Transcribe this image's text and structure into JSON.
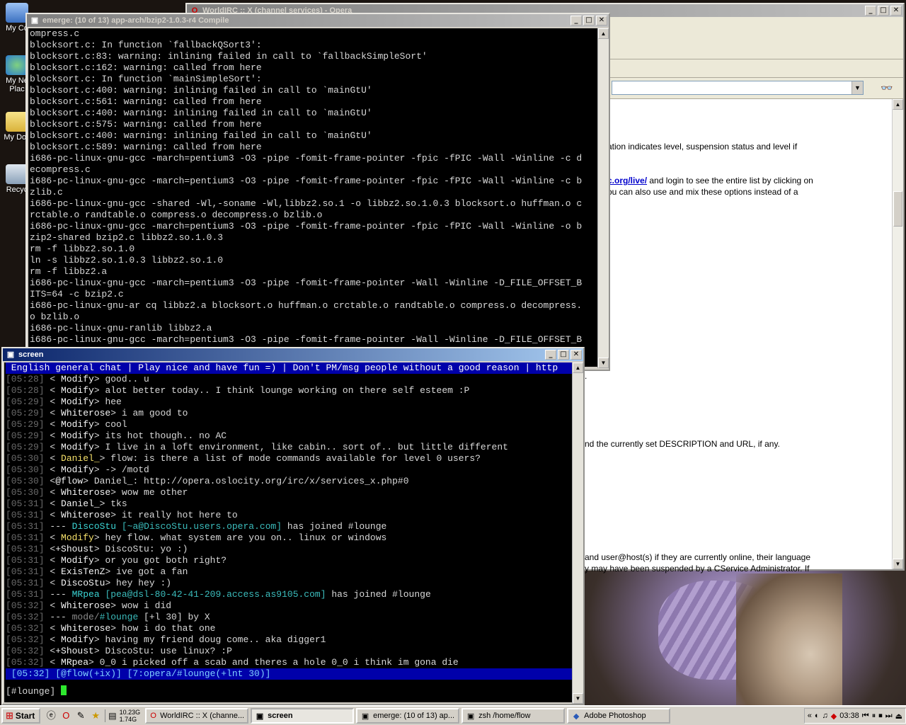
{
  "desktop": {
    "icons": [
      {
        "label": "My Co",
        "name": "my-computer"
      },
      {
        "label": "My Ne Plac",
        "name": "my-network-places"
      },
      {
        "label": "My Doc",
        "name": "my-documents"
      },
      {
        "label": "Recyc",
        "name": "recycle-bin"
      }
    ]
  },
  "opera": {
    "title": "WorldIRC :: X (channel services) - Opera",
    "lines": [
      "ation indicates level, suspension status and level if",
      "and login to see the entire list by clicking on",
      "ou can also use and mix these options instead of a",
      "nd the currently set DESCRIPTION and URL, if any.",
      "and user@host(s) if they are currently online, their language",
      "y may have been suspended by a CService Administrator. If"
    ],
    "link": "c.org/live/",
    "fragment": "."
  },
  "emerge": {
    "title": "emerge: (10 of 13) app-arch/bzip2-1.0.3-r4 Compile",
    "lines": [
      "ompress.c",
      "blocksort.c: In function `fallbackQSort3':",
      "blocksort.c:83: warning: inlining failed in call to `fallbackSimpleSort'",
      "blocksort.c:162: warning: called from here",
      "blocksort.c: In function `mainSimpleSort':",
      "blocksort.c:400: warning: inlining failed in call to `mainGtU'",
      "blocksort.c:561: warning: called from here",
      "blocksort.c:400: warning: inlining failed in call to `mainGtU'",
      "blocksort.c:575: warning: called from here",
      "blocksort.c:400: warning: inlining failed in call to `mainGtU'",
      "blocksort.c:589: warning: called from here",
      "i686-pc-linux-gnu-gcc -march=pentium3 -O3 -pipe -fomit-frame-pointer -fpic -fPIC -Wall -Winline -c d",
      "ecompress.c",
      "i686-pc-linux-gnu-gcc -march=pentium3 -O3 -pipe -fomit-frame-pointer -fpic -fPIC -Wall -Winline -c b",
      "zlib.c",
      "i686-pc-linux-gnu-gcc -shared -Wl,-soname -Wl,libbz2.so.1 -o libbz2.so.1.0.3 blocksort.o huffman.o c",
      "rctable.o randtable.o compress.o decompress.o bzlib.o",
      "i686-pc-linux-gnu-gcc -march=pentium3 -O3 -pipe -fomit-frame-pointer -fpic -fPIC -Wall -Winline -o b",
      "zip2-shared bzip2.c libbz2.so.1.0.3",
      "rm -f libbz2.so.1.0",
      "ln -s libbz2.so.1.0.3 libbz2.so.1.0",
      "rm -f libbz2.a",
      "i686-pc-linux-gnu-gcc -march=pentium3 -O3 -pipe -fomit-frame-pointer -Wall -Winline -D_FILE_OFFSET_B",
      "ITS=64 -c bzip2.c",
      "i686-pc-linux-gnu-ar cq libbz2.a blocksort.o huffman.o crctable.o randtable.o compress.o decompress.",
      "o bzlib.o",
      "i686-pc-linux-gnu-ranlib libbz2.a",
      "i686-pc-linux-gnu-gcc -march=pentium3 -O3 -pipe -fomit-frame-pointer -Wall -Winline -D_FILE_OFFSET_B"
    ]
  },
  "screen": {
    "title": "screen",
    "topic": " English general chat | Play nice and have fun =) | Don't PM/msg people without a good reason | http",
    "messages": [
      {
        "t": "[05:28]",
        "p": " < ",
        "n": "Modify",
        "c": "nick",
        "s": "> ",
        "m": "good.. u"
      },
      {
        "t": "[05:28]",
        "p": " < ",
        "n": "Modify",
        "c": "nick",
        "s": "> ",
        "m": "alot better today.. I think lounge working on there self esteem :P"
      },
      {
        "t": "[05:29]",
        "p": " < ",
        "n": "Modify",
        "c": "nick",
        "s": "> ",
        "m": "hee"
      },
      {
        "t": "[05:29]",
        "p": " < ",
        "n": "Whiterose",
        "c": "nick",
        "s": "> ",
        "m": "i am good to"
      },
      {
        "t": "[05:29]",
        "p": " < ",
        "n": "Modify",
        "c": "nick",
        "s": "> ",
        "m": "cool"
      },
      {
        "t": "[05:29]",
        "p": " < ",
        "n": "Modify",
        "c": "nick",
        "s": "> ",
        "m": "its hot though.. no AC"
      },
      {
        "t": "[05:29]",
        "p": " < ",
        "n": "Modify",
        "c": "nick",
        "s": "> ",
        "m": "I live in a loft environment, like cabin.. sort of.. but little different"
      },
      {
        "t": "[05:30]",
        "p": " < ",
        "n": "Daniel_",
        "c": "nick-y",
        "s": "> ",
        "m": "flow: is there a list of mode commands available for level 0 users?"
      },
      {
        "t": "[05:30]",
        "p": " < ",
        "n": "Modify",
        "c": "nick",
        "s": "> ",
        "m": "-> /motd"
      },
      {
        "t": "[05:30]",
        "p": " <",
        "n": "@flow",
        "c": "nick",
        "s": "> ",
        "m": "Daniel_: http://opera.oslocity.org/irc/x/services_x.php#0"
      },
      {
        "t": "[05:30]",
        "p": " < ",
        "n": "Whiterose",
        "c": "nick",
        "s": "> ",
        "m": "wow me other"
      },
      {
        "t": "[05:31]",
        "p": " < ",
        "n": "Daniel_",
        "c": "nick",
        "s": "> ",
        "m": "tks"
      },
      {
        "t": "[05:31]",
        "p": " < ",
        "n": "Whiterose",
        "c": "nick",
        "s": "> ",
        "m": "it really hot here to"
      },
      {
        "t": "[05:31]",
        "p": " --- ",
        "n": "DiscoStu",
        "c": "nick-c",
        "s": " ",
        "h": "[~a@DiscoStu.users.opera.com]",
        "m": " has joined #lounge"
      },
      {
        "t": "[05:31]",
        "p": " < ",
        "n": "Modify",
        "c": "nick-y",
        "s": "> ",
        "m": "hey flow. what system are you on.. linux or windows"
      },
      {
        "t": "[05:31]",
        "p": " <",
        "n": "+Shoust",
        "c": "nick",
        "s": "> ",
        "m": "DiscoStu: yo :)"
      },
      {
        "t": "[05:31]",
        "p": " < ",
        "n": "Modify",
        "c": "nick",
        "s": "> ",
        "m": "or you got both right?"
      },
      {
        "t": "[05:31]",
        "p": " < ",
        "n": "ExisTenZ",
        "c": "nick",
        "s": "> ",
        "m": "ive got a fan"
      },
      {
        "t": "[05:31]",
        "p": " < ",
        "n": "DiscoStu",
        "c": "nick",
        "s": "> ",
        "m": "hey hey :)"
      },
      {
        "t": "[05:31]",
        "p": " --- ",
        "n": "MRpea",
        "c": "nick-c",
        "s": " ",
        "h": "[pea@dsl-80-42-41-209.access.as9105.com]",
        "m": " has joined #lounge"
      },
      {
        "t": "[05:32]",
        "p": " < ",
        "n": "Whiterose",
        "c": "nick",
        "s": "> ",
        "m": "wow i did"
      },
      {
        "t": "[05:32]",
        "p": " --- ",
        "n": "mode/",
        "c": "dim",
        "s": "",
        "h": "#lounge",
        "m": " [+l 30] by X"
      },
      {
        "t": "[05:32]",
        "p": " < ",
        "n": "Whiterose",
        "c": "nick",
        "s": "> ",
        "m": "how i do that one"
      },
      {
        "t": "[05:32]",
        "p": " < ",
        "n": "Modify",
        "c": "nick",
        "s": "> ",
        "m": "having my friend doug come.. aka digger1"
      },
      {
        "t": "[05:32]",
        "p": " <",
        "n": "+Shoust",
        "c": "nick",
        "s": "> ",
        "m": "DiscoStu: use linux? :P"
      },
      {
        "t": "[05:32]",
        "p": " < ",
        "n": "MRpea",
        "c": "nick",
        "s": "> ",
        "m": "0_0 i picked off a scab and theres a hole 0_0 i think im gona die"
      }
    ],
    "status": " [05:32] [@flow(+ix)] [7:opera/#lounge(+lnt 30)]",
    "prompt": "[#lounge] "
  },
  "taskbar": {
    "start": "Start",
    "mem_top": "10.23G",
    "mem_bottom": "1.74G",
    "tasks": [
      {
        "label": "WorldIRC :: X (channe...",
        "icon": "opera-icon",
        "active": false
      },
      {
        "label": "screen",
        "icon": "putty-icon",
        "active": true
      },
      {
        "label": "emerge: (10 of 13) ap...",
        "icon": "putty-icon",
        "active": false
      },
      {
        "label": "zsh /home/flow",
        "icon": "putty-icon",
        "active": false
      },
      {
        "label": "Adobe Photoshop",
        "icon": "photoshop-icon",
        "active": false
      }
    ],
    "clock": "03:38"
  }
}
